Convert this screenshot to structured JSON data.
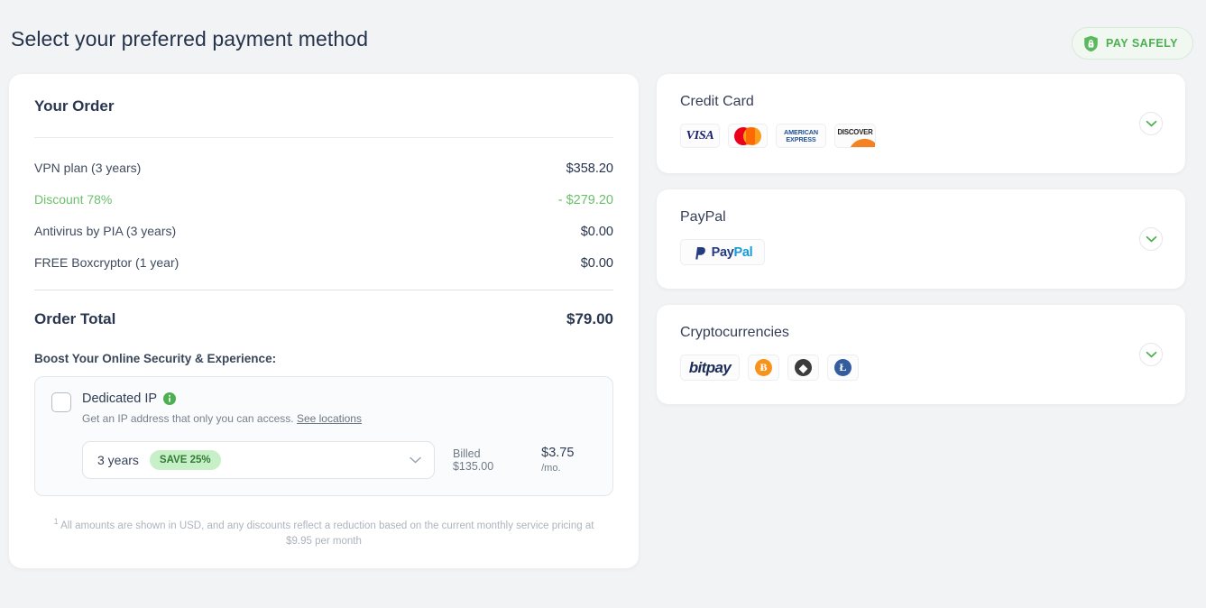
{
  "header": {
    "title": "Select your preferred payment method",
    "badge_label": "PAY SAFELY",
    "badge_icon": "shield-lock-icon",
    "badge_color": "#4caf50"
  },
  "order": {
    "heading": "Your Order",
    "items": [
      {
        "label": "VPN plan (3 years)",
        "amount": "$358.20",
        "discount": false
      },
      {
        "label": "Discount 78%",
        "amount": "- $279.20",
        "discount": true
      },
      {
        "label": "Antivirus by PIA (3 years)",
        "amount": "$0.00",
        "discount": false
      },
      {
        "label": "FREE Boxcryptor (1 year)",
        "amount": "$0.00",
        "discount": false
      }
    ],
    "total_label": "Order Total",
    "total_amount": "$79.00",
    "boost_label": "Boost Your Online Security & Experience:",
    "addon": {
      "checkbox_checked": false,
      "title": "Dedicated IP",
      "info_icon": "info-circle-icon",
      "description": "Get an IP address that only you can access.",
      "link_label": "See locations",
      "term_value": "3 years",
      "save_badge": "SAVE 25%",
      "chevron_icon": "chevron-down-icon",
      "billed_label": "Billed $135.00",
      "monthly_price": "$3.75",
      "monthly_suffix": "/mo."
    },
    "footnote_marker": "1",
    "footnote": "All amounts are shown in USD, and any discounts reflect a reduction based on the current monthly service pricing at $9.95 per month"
  },
  "payment_methods": [
    {
      "title": "Credit Card",
      "expand_icon": "chevron-down-icon",
      "logos": [
        {
          "name": "visa-logo",
          "label": "VISA"
        },
        {
          "name": "mastercard-logo",
          "label": "Mastercard"
        },
        {
          "name": "amex-logo",
          "label_line1": "AMERICAN",
          "label_line2": "EXPRESS"
        },
        {
          "name": "discover-logo",
          "label": "DISCOVER"
        }
      ]
    },
    {
      "title": "PayPal",
      "expand_icon": "chevron-down-icon",
      "logos": [
        {
          "name": "paypal-logo",
          "label_a": "Pay",
          "label_b": "Pal"
        }
      ]
    },
    {
      "title": "Cryptocurrencies",
      "expand_icon": "chevron-down-icon",
      "logos": [
        {
          "name": "bitpay-logo",
          "label": "bitpay"
        },
        {
          "name": "bitcoin-logo",
          "label": "Ƀ"
        },
        {
          "name": "ethereum-logo",
          "label": "◆"
        },
        {
          "name": "litecoin-logo",
          "label": "Ł"
        }
      ]
    }
  ],
  "colors": {
    "accent_green": "#4caf50",
    "discount_green": "#6cbf6c",
    "page_bg": "#f2f3f4"
  }
}
